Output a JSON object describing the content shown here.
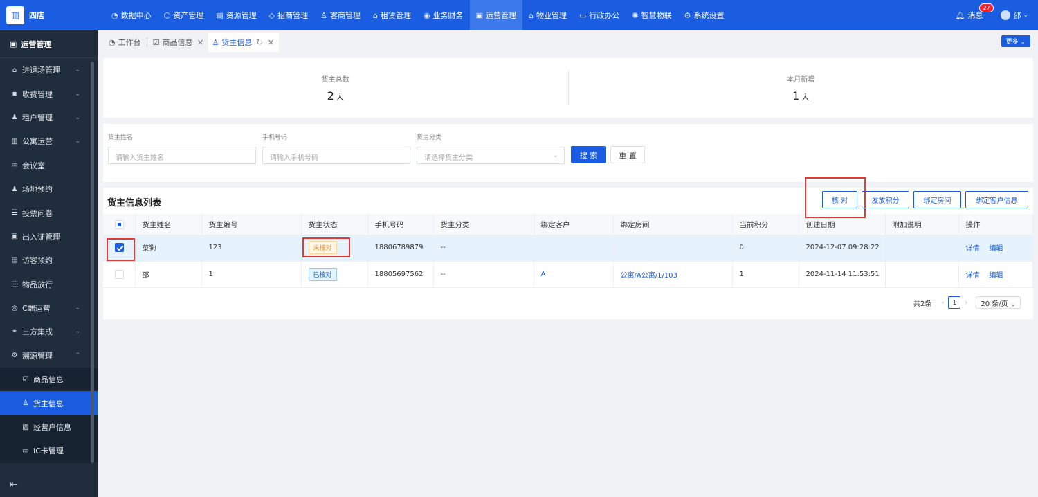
{
  "brand": {
    "name": "四店"
  },
  "nav": [
    {
      "icon": "◔",
      "label": "数据中心"
    },
    {
      "icon": "⬡",
      "label": "资产管理"
    },
    {
      "icon": "▤",
      "label": "资源管理"
    },
    {
      "icon": "◇",
      "label": "招商管理"
    },
    {
      "icon": "♙",
      "label": "客商管理"
    },
    {
      "icon": "⌂",
      "label": "租赁管理"
    },
    {
      "icon": "◉",
      "label": "业务财务"
    },
    {
      "icon": "▣",
      "label": "运营管理"
    },
    {
      "icon": "⌂",
      "label": "物业管理"
    },
    {
      "icon": "▭",
      "label": "行政办公"
    },
    {
      "icon": "✺",
      "label": "智慧物联"
    },
    {
      "icon": "⚙",
      "label": "系统设置"
    }
  ],
  "top_right": {
    "message_label": "消息",
    "message_count": "27",
    "user_name": "邵"
  },
  "sidebar": {
    "title": "运营管理",
    "items": [
      {
        "icon": "⌂",
        "label": "进退场管理",
        "arrow": "⌄"
      },
      {
        "icon": "▪",
        "label": "收费管理",
        "arrow": "⌄"
      },
      {
        "icon": "♟",
        "label": "租户管理",
        "arrow": "⌄"
      },
      {
        "icon": "▥",
        "label": "公寓运营",
        "arrow": "⌄"
      },
      {
        "icon": "▭",
        "label": "会议室",
        "arrow": ""
      },
      {
        "icon": "♟",
        "label": "场地预约",
        "arrow": ""
      },
      {
        "icon": "☰",
        "label": "投票问卷",
        "arrow": ""
      },
      {
        "icon": "▣",
        "label": "出入证管理",
        "arrow": ""
      },
      {
        "icon": "▤",
        "label": "访客预约",
        "arrow": ""
      },
      {
        "icon": "⬚",
        "label": "物品放行",
        "arrow": ""
      },
      {
        "icon": "◎",
        "label": "C端运营",
        "arrow": "⌄"
      },
      {
        "icon": "⚭",
        "label": "三方集成",
        "arrow": "⌄"
      },
      {
        "icon": "⚙",
        "label": "溯源管理",
        "arrow": "⌃"
      }
    ],
    "sub_items": [
      {
        "icon": "☑",
        "label": "商品信息"
      },
      {
        "icon": "♙",
        "label": "货主信息"
      },
      {
        "icon": "▨",
        "label": "经营户信息"
      },
      {
        "icon": "▭",
        "label": "IC卡管理"
      }
    ],
    "collapse_icon": "⇤"
  },
  "tabs": [
    {
      "icon": "◔",
      "label": "工作台",
      "close": ""
    },
    {
      "icon": "☑",
      "label": "商品信息",
      "close": "×"
    },
    {
      "icon": "♙",
      "label": "货主信息",
      "close": "×",
      "refresh": "↻"
    }
  ],
  "more_label": "更多 ⌄",
  "stats": [
    {
      "label": "货主总数",
      "value": "2",
      "unit": "人"
    },
    {
      "label": "本月新增",
      "value": "1",
      "unit": "人"
    }
  ],
  "search": {
    "fields": [
      {
        "label": "货主姓名",
        "placeholder": "请输入货主姓名"
      },
      {
        "label": "手机号码",
        "placeholder": "请输入手机号码"
      },
      {
        "label": "货主分类",
        "placeholder": "请选择货主分类"
      }
    ],
    "search_label": "搜 索",
    "reset_label": "重 置"
  },
  "table": {
    "title": "货主信息列表",
    "actions": [
      "核 对",
      "发放积分",
      "绑定房间",
      "绑定客户信息"
    ],
    "columns": [
      "",
      "货主姓名",
      "货主编号",
      "货主状态",
      "手机号码",
      "货主分类",
      "绑定客户",
      "绑定房间",
      "当前积分",
      "创建日期",
      "附加说明",
      "操作"
    ],
    "rows": [
      {
        "name": "菜狗",
        "code": "123",
        "status": "未核对",
        "status_type": "warn",
        "phone": "18806789879",
        "category": "--",
        "customer": "",
        "room": "",
        "points": "0",
        "created": "2024-12-07 09:28:22",
        "note": "",
        "op_detail": "详情",
        "op_edit": "编辑",
        "checked": true
      },
      {
        "name": "邵",
        "code": "1",
        "status": "已核对",
        "status_type": "ok",
        "phone": "18805697562",
        "category": "--",
        "customer": "A",
        "room": "公寓/A公寓/1/103",
        "points": "1",
        "created": "2024-11-14 11:53:51",
        "note": "",
        "op_detail": "详情",
        "op_edit": "编辑",
        "checked": false
      }
    ]
  },
  "pagination": {
    "total": "共2条",
    "current": "1",
    "page_size": "20 条/页 ⌄",
    "prev": "‹",
    "next": "›"
  },
  "colors": {
    "primary": "#1a5de0",
    "sidebar": "#1f2d3d",
    "highlight": "#e53935"
  }
}
